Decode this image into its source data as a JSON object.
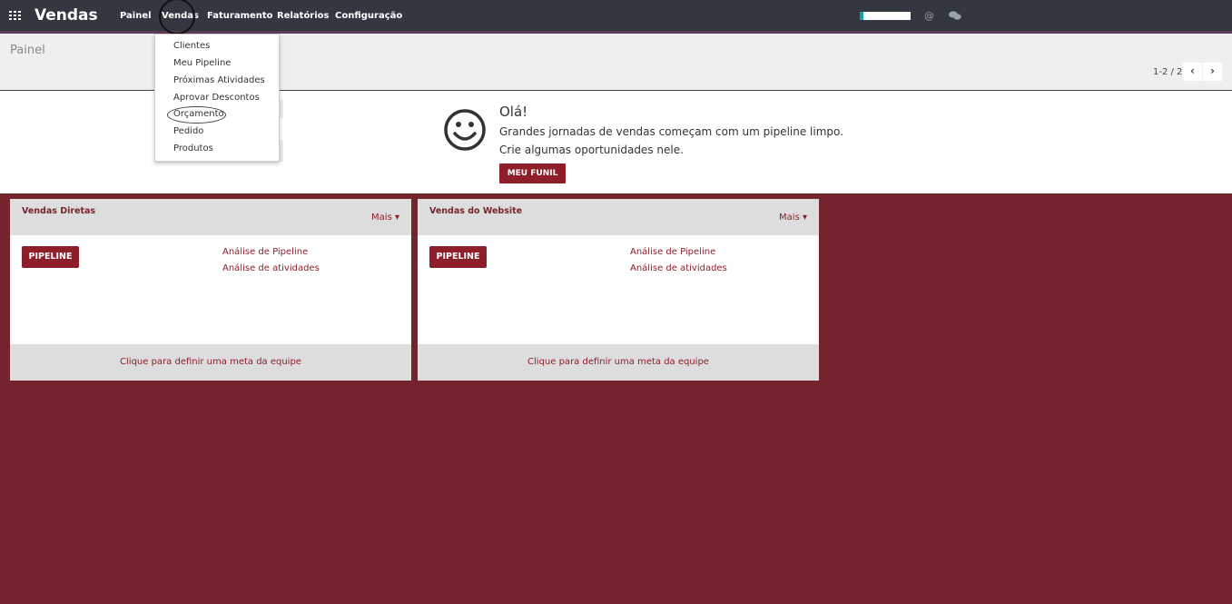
{
  "topbar": {
    "app_title": "Vendas",
    "menu": [
      "Painel",
      "Vendas",
      "Faturamento",
      "Relatórios",
      "Configuração"
    ]
  },
  "dropdown": {
    "items": [
      "Clientes",
      "Meu Pipeline",
      "Próximas Atividades",
      "Aprovar Descontos",
      "Orçamento",
      "Pedido",
      "Produtos"
    ]
  },
  "control": {
    "title": "Painel",
    "pager": "1-2 / 2"
  },
  "greeting": {
    "hello": "Olá!",
    "line1": "Grandes jornadas de vendas começam com um pipeline limpo.",
    "line2": "Crie algumas oportunidades nele.",
    "button": "MEU FUNIL"
  },
  "teams": [
    {
      "name": "Vendas Diretas",
      "more": "Mais",
      "pipeline_button": "PIPELINE",
      "links": [
        "Análise de Pipeline",
        "Análise de atividades"
      ],
      "goal": "Clique para definir uma meta da equipe"
    },
    {
      "name": "Vendas do Website",
      "more": "Mais",
      "pipeline_button": "PIPELINE",
      "links": [
        "Análise de Pipeline",
        "Análise de atividades"
      ],
      "goal": "Clique para definir uma meta da equipe"
    }
  ],
  "colors": {
    "brand": "#75232d",
    "button": "#8d1e2a",
    "topbar": "#33373f"
  }
}
